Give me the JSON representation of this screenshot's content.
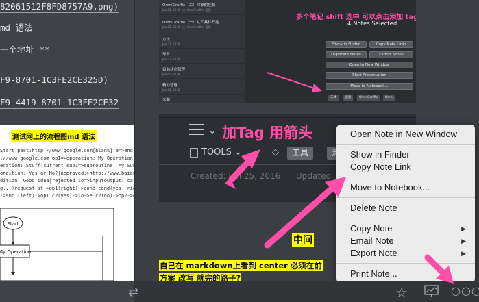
{
  "editor": {
    "lines": [
      "82061512F8FD8757A9.png)",
      "md 语法",
      "一个地址 **",
      "F9-8701-1C3FE2CE325D)",
      "F9-4419-8701-1C3FE2CE32"
    ],
    "preview": {
      "title": "测试网上的流程图md 语法",
      "code_lines": [
        "Start|past:http://www.google.com[blank] e=>end:",
        "://www.google.com op1=>operation: My Operation|past",
        "eration: Stuff|current sub1=>subroutine: My Subroutine|i",
        "ondition: Yes or No?|approved:>http://www.baidu.com",
        "dition: Good idea|rejected io=>inputoutput: catch",
        "g...)request st->op1(right)->cond cond(yes, right)->c2",
        "->sub1(left)->op1 c2(yes)->io->e c2(no)->op2->e"
      ],
      "flow_start": "Start",
      "flow_operation": "My Operation"
    }
  },
  "shot1": {
    "notes": [
      {
        "title": "OmniGraffle（二）对象的控制",
        "date": "Jun 25, 2016 · 工, OmniGraffle, 画图"
      },
      {
        "title": "OmniGraffle（一）从工具栏开始",
        "date": "Jun 25, 2016 · 工, OmniGraffle, 画图"
      },
      {
        "title": "方法",
        "date": "Jun 21, 2016"
      },
      {
        "title": "专业",
        "date": "Jun 21, 2016"
      },
      {
        "title": "目前状态管理",
        "date": "Jun 05, 2016"
      },
      {
        "title": "精力管理",
        "date": "Jun 05, 2016"
      },
      {
        "title": "大脑",
        "date": ""
      }
    ],
    "title": "多个笔记 shift 选中 可以点击添加 tag",
    "subtitle": "4 Notes Selected",
    "buttons": {
      "show_in_finder": "Show in Finder",
      "copy_note_links": "Copy Note Links",
      "duplicate_notes": "Duplicate Notes",
      "export_notes": "Export Notes",
      "open_new_window": "Open in New Window",
      "start_presentation": "Start Presentation",
      "move_to_notebook": "Move to Notebook..."
    },
    "tags": [
      "工具",
      "画图",
      "OmniGraffle",
      "Omni"
    ]
  },
  "shot2": {
    "tools_label": "TOOLS ⌄",
    "tags": [
      "工具",
      "流程图"
    ],
    "created": "Created: Jun 25, 2016",
    "updated": "Updated",
    "add_tag_annotation": "加Tag 用箭头",
    "middle_label": "中间"
  },
  "highlights": {
    "line1": "自己在 markdown上看到 center 必须在前",
    "line2": "方案 改写 就完的路子?"
  },
  "context_menu": {
    "open_new_window": "Open Note in New Window",
    "show_in_finder": "Show in Finder",
    "copy_note_link": "Copy Note Link",
    "move_to_notebook": "Move to Notebook...",
    "delete_note": "Delete Note",
    "copy_note": "Copy Note",
    "email_note": "Email Note",
    "export_note": "Export Note",
    "print_note": "Print Note..."
  },
  "colors": {
    "annotation_pink": "#ff4fa8",
    "highlight_yellow": "#ffff00",
    "menu_bg": "#ececec"
  }
}
